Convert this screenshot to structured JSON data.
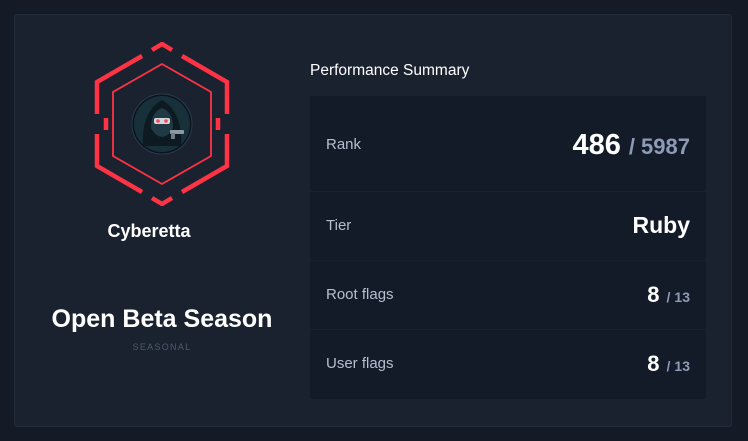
{
  "profile": {
    "username": "Cyberetta",
    "avatar_icon": "hooded-figure-avatar-icon",
    "badge_color": "#ff3344"
  },
  "season": {
    "name": "Open Beta Season",
    "type": "SEASONAL"
  },
  "summary": {
    "title": "Performance Summary",
    "rank": {
      "label": "Rank",
      "value": "486",
      "separator": "/",
      "total": "5987"
    },
    "tier": {
      "label": "Tier",
      "value": "Ruby"
    },
    "root_flags": {
      "label": "Root flags",
      "value": "8",
      "separator": "/",
      "total": "13"
    },
    "user_flags": {
      "label": "User flags",
      "value": "8",
      "separator": "/",
      "total": "13"
    }
  }
}
